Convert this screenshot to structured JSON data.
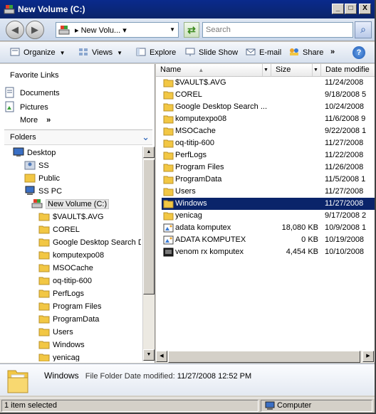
{
  "window": {
    "title": "New Volume (C:)",
    "controls": {
      "minimize": "_",
      "maximize": "□",
      "close": "X"
    }
  },
  "address": {
    "path": "New Volu...",
    "search_placeholder": "Search"
  },
  "toolbar": {
    "organize": "Organize",
    "views": "Views",
    "explore": "Explore",
    "slideshow": "Slide Show",
    "email": "E-mail",
    "share": "Share",
    "overflow": "»",
    "help": "?"
  },
  "nav": {
    "favorites_header": "Favorite Links",
    "favorites": [
      {
        "label": "Documents",
        "icon": "documents-icon"
      },
      {
        "label": "Pictures",
        "icon": "pictures-icon"
      }
    ],
    "more_label": "More",
    "more_chevron": "»",
    "folders_header": "Folders",
    "tree": [
      {
        "label": "Desktop",
        "icon": "desktop-icon"
      },
      {
        "label": "SS",
        "icon": "user-folder-icon"
      },
      {
        "label": "Public",
        "icon": "user-folder-icon"
      },
      {
        "label": "SS PC",
        "icon": "computer-icon"
      },
      {
        "label": "New Volume (C:)",
        "icon": "drive-icon"
      },
      {
        "label": "$VAULT$.AVG",
        "icon": "folder-icon"
      },
      {
        "label": "COREL",
        "icon": "folder-icon"
      },
      {
        "label": "Google Desktop Search Da",
        "icon": "folder-icon"
      },
      {
        "label": "komputexpo08",
        "icon": "folder-icon"
      },
      {
        "label": "MSOCache",
        "icon": "folder-icon"
      },
      {
        "label": "oq-titip-600",
        "icon": "folder-icon"
      },
      {
        "label": "PerfLogs",
        "icon": "folder-icon"
      },
      {
        "label": "Program Files",
        "icon": "folder-icon"
      },
      {
        "label": "ProgramData",
        "icon": "folder-icon"
      },
      {
        "label": "Users",
        "icon": "folder-icon"
      },
      {
        "label": "Windows",
        "icon": "folder-icon"
      },
      {
        "label": "yenicag",
        "icon": "folder-icon"
      }
    ]
  },
  "files": {
    "columns": {
      "name": "Name",
      "size": "Size",
      "date": "Date modifie"
    },
    "rows": [
      {
        "name": "$VAULT$.AVG",
        "size": "",
        "date": "11/24/2008",
        "icon": "folder-icon"
      },
      {
        "name": "COREL",
        "size": "",
        "date": "9/18/2008 5",
        "icon": "folder-icon"
      },
      {
        "name": "Google Desktop Search ...",
        "size": "",
        "date": "10/24/2008",
        "icon": "folder-icon"
      },
      {
        "name": "komputexpo08",
        "size": "",
        "date": "11/6/2008 9",
        "icon": "folder-icon"
      },
      {
        "name": "MSOCache",
        "size": "",
        "date": "9/22/2008 1",
        "icon": "folder-icon"
      },
      {
        "name": "oq-titip-600",
        "size": "",
        "date": "11/27/2008",
        "icon": "folder-icon"
      },
      {
        "name": "PerfLogs",
        "size": "",
        "date": "11/22/2008",
        "icon": "folder-icon"
      },
      {
        "name": "Program Files",
        "size": "",
        "date": "11/26/2008",
        "icon": "folder-icon"
      },
      {
        "name": "ProgramData",
        "size": "",
        "date": "11/5/2008 1",
        "icon": "folder-icon"
      },
      {
        "name": "Users",
        "size": "",
        "date": "11/27/2008",
        "icon": "folder-icon"
      },
      {
        "name": "Windows",
        "size": "",
        "date": "11/27/2008",
        "icon": "folder-icon",
        "selected": true
      },
      {
        "name": "yenicag",
        "size": "",
        "date": "9/17/2008 2",
        "icon": "folder-icon"
      },
      {
        "name": "adata komputex",
        "size": "18,080 KB",
        "date": "10/9/2008 1",
        "icon": "image-file-icon"
      },
      {
        "name": "ADATA KOMPUTEX",
        "size": "0 KB",
        "date": "10/19/2008",
        "icon": "image-file-icon"
      },
      {
        "name": "venom rx komputex",
        "size": "4,454 KB",
        "date": "10/10/2008",
        "icon": "video-file-icon"
      }
    ]
  },
  "details": {
    "name": "Windows",
    "type": "File Folder",
    "date_label": "Date modified:",
    "date_value": "11/27/2008 12:52 PM"
  },
  "status": {
    "selection": "1 item selected",
    "location": "Computer"
  },
  "colors": {
    "title_bar": "#0a246a",
    "selection": "#0a246a",
    "folder": "#f2c744"
  }
}
